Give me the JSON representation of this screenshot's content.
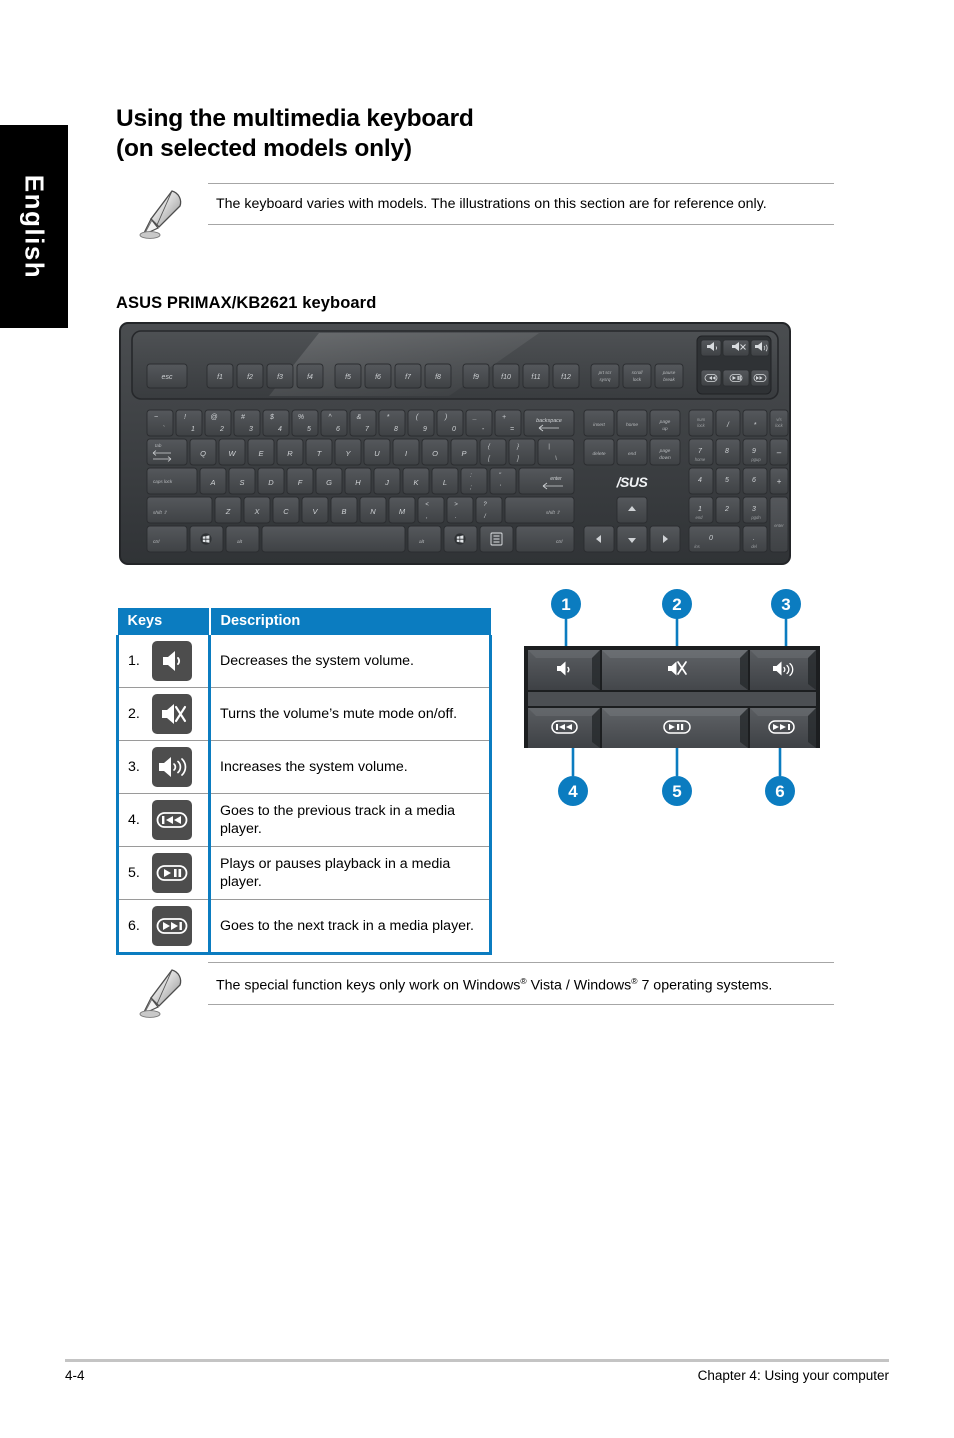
{
  "language_tab": {
    "label": "English"
  },
  "page_title": {
    "line1": "Using the multimedia keyboard",
    "line2": "(on selected models only)"
  },
  "note_top": {
    "icon": "quill-pen-icon",
    "text": "The keyboard varies with models. The illustrations on this section are for reference only."
  },
  "section_heading": "ASUS PRIMAX/KB2621 keyboard",
  "keyboard_figure": {
    "brand_logo": "/SUS",
    "function_row": [
      "esc",
      "f1",
      "f2",
      "f3",
      "f4",
      "f5",
      "f6",
      "f7",
      "f8",
      "f9",
      "f10",
      "f11",
      "f12"
    ],
    "system_keys": [
      "prt scr sysrq",
      "scroll lock",
      "pause break"
    ],
    "media_keys_top": [
      "volume-down-icon",
      "mute-icon",
      "volume-up-icon"
    ],
    "media_keys_bottom": [
      "prev-track-icon",
      "play-pause-icon",
      "next-track-icon"
    ],
    "number_row": [
      "~ `",
      "! 1",
      "@ 2",
      "# 3",
      "$ 4",
      "% 5",
      "^ 6",
      "& 7",
      "* 8",
      "( 9",
      ") 0",
      "_ -",
      "+ =",
      "backspace"
    ],
    "tab_row": [
      "tab",
      "Q",
      "W",
      "E",
      "R",
      "T",
      "Y",
      "U",
      "I",
      "O",
      "P",
      "{ [",
      "} ]",
      "| \\"
    ],
    "caps_row": [
      "caps lock",
      "A",
      "S",
      "D",
      "F",
      "G",
      "H",
      "J",
      "K",
      "L",
      ": ;",
      "\" '",
      "enter"
    ],
    "shift_row": [
      "shift",
      "Z",
      "X",
      "C",
      "V",
      "B",
      "N",
      "M",
      "< ,",
      "> .",
      "? /",
      "shift"
    ],
    "ctrl_row": [
      "ctrl",
      "win-key-icon",
      "alt",
      "space",
      "alt",
      "win-key-icon",
      "menu-key-icon",
      "ctrl"
    ],
    "nav_cluster": [
      "insert",
      "home",
      "page up",
      "delete",
      "end",
      "page down"
    ],
    "arrow_keys": [
      "up-arrow",
      "left-arrow",
      "down-arrow",
      "right-arrow"
    ],
    "numpad": [
      "num lock",
      "/",
      "*",
      "v/s lock",
      "7 home",
      "8",
      "9 pgup",
      "-",
      "4",
      "5",
      "6",
      "+",
      "1 end",
      "2",
      "3 pgdn",
      "0 ins",
      ". del",
      "enter"
    ]
  },
  "keys_table": {
    "headers": {
      "keys": "Keys",
      "description": "Description"
    },
    "rows": [
      {
        "num": "1.",
        "icon": "volume-down-icon",
        "description": "Decreases the system volume."
      },
      {
        "num": "2.",
        "icon": "mute-icon",
        "description": "Turns the volume’s mute mode on/off."
      },
      {
        "num": "3.",
        "icon": "volume-up-icon",
        "description": "Increases the system volume."
      },
      {
        "num": "4.",
        "icon": "prev-track-icon",
        "description": "Goes to the previous track in a media player."
      },
      {
        "num": "5.",
        "icon": "play-pause-icon",
        "description": "Plays or pauses playback in a media player."
      },
      {
        "num": "6.",
        "icon": "next-track-icon",
        "description": "Goes to the next track in a media player."
      }
    ]
  },
  "media_figure": {
    "callouts_top": [
      "1",
      "2",
      "3"
    ],
    "callouts_bottom": [
      "4",
      "5",
      "6"
    ],
    "keys_top": [
      "volume-down-icon",
      "mute-icon",
      "volume-up-icon"
    ],
    "keys_bottom": [
      "prev-track-icon",
      "play-pause-icon",
      "next-track-icon"
    ],
    "callout_color": "#0b7cc0"
  },
  "note_bottom": {
    "icon": "quill-pen-icon",
    "text_part1": "The special function keys only work on Windows",
    "sup1": "®",
    "text_part2": " Vista / Windows",
    "sup2": "®",
    "text_part3": " 7 operating systems."
  },
  "footer": {
    "page_number": "4-4",
    "chapter": "Chapter 4: Using your computer"
  },
  "colors": {
    "accent_blue": "#0b7cc0",
    "icon_gray": "#4d4d4d",
    "keyboard_body": "#3b3d3f",
    "rule_gray": "#a6a6a6"
  }
}
